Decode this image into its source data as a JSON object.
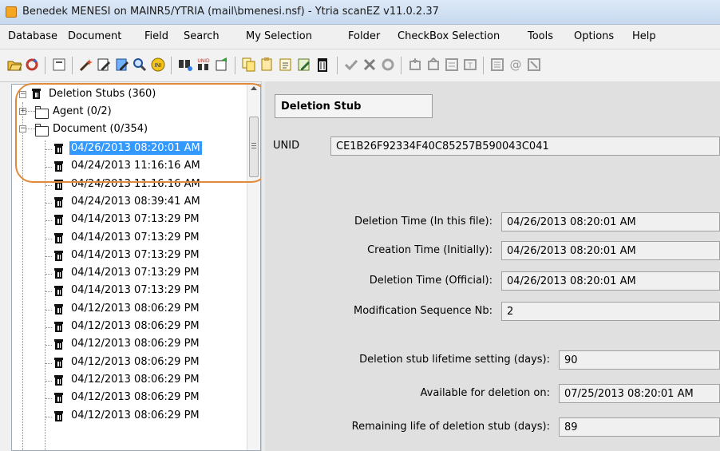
{
  "window": {
    "title": "Benedek MENESI on MAINR5/YTRIA (mail\\bmenesi.nsf) - Ytria scanEZ v11.0.2.37",
    "icon": "scanez-app-icon"
  },
  "menu": [
    "Database",
    "Document",
    "Field",
    "Search",
    "My Selection",
    "Folder",
    "CheckBox Selection",
    "Tools",
    "Options",
    "Help"
  ],
  "toolbar_icons": [
    "open-database-icon",
    "refresh-icon",
    "select-icon",
    "magic-wand-icon",
    "edit-document-icon",
    "edit-color-icon",
    "search-icon",
    "ini-icon",
    "find-icon",
    "unid-icon",
    "export-icon",
    "copy-icon",
    "paste-icon",
    "new-document-icon",
    "edit-note-icon",
    "delete-icon",
    "check-icon",
    "cancel-icon",
    "reset-icon",
    "bookmark-add-icon",
    "bookmark-icon",
    "form-icon",
    "field-icon",
    "list-icon",
    "at-sign-icon",
    "more-icon"
  ],
  "tree": {
    "root": {
      "label": "Deletion Stubs  (360)"
    },
    "folders": [
      {
        "label": "Agent  (0/2)"
      },
      {
        "label": "Document  (0/354)"
      }
    ],
    "stubs": [
      "04/26/2013 08:20:01 AM",
      "04/24/2013 11:16:16 AM",
      "04/24/2013 11:16:16 AM",
      "04/24/2013 08:39:41 AM",
      "04/14/2013 07:13:29 PM",
      "04/14/2013 07:13:29 PM",
      "04/14/2013 07:13:29 PM",
      "04/14/2013 07:13:29 PM",
      "04/14/2013 07:13:29 PM",
      "04/12/2013 08:06:29 PM",
      "04/12/2013 08:06:29 PM",
      "04/12/2013 08:06:29 PM",
      "04/12/2013 08:06:29 PM",
      "04/12/2013 08:06:29 PM",
      "04/12/2013 08:06:29 PM",
      "04/12/2013 08:06:29 PM"
    ],
    "selected_index": 0
  },
  "details": {
    "section_title": "Deletion Stub",
    "unid_label": "UNID",
    "unid_value": "CE1B26F92334F40C85257B590043C041",
    "fields": [
      {
        "label": "Deletion Time (In this file):",
        "value": "04/26/2013 08:20:01 AM"
      },
      {
        "label": "Creation Time (Initially):",
        "value": "04/26/2013 08:20:01 AM"
      },
      {
        "label": "Deletion Time (Official):",
        "value": "04/26/2013 08:20:01 AM"
      },
      {
        "label": "Modification Sequence Nb:",
        "value": "2"
      }
    ],
    "lifetime": [
      {
        "label": "Deletion stub lifetime setting (days):",
        "value": "90"
      },
      {
        "label": "Available for deletion on:",
        "value": "07/25/2013 08:20:01 AM"
      },
      {
        "label": "Remaining life of deletion stub (days):",
        "value": "89"
      }
    ]
  },
  "colors": {
    "selection": "#3399ff",
    "annotation": "#e08a3a",
    "panel": "#e0e0e0"
  }
}
